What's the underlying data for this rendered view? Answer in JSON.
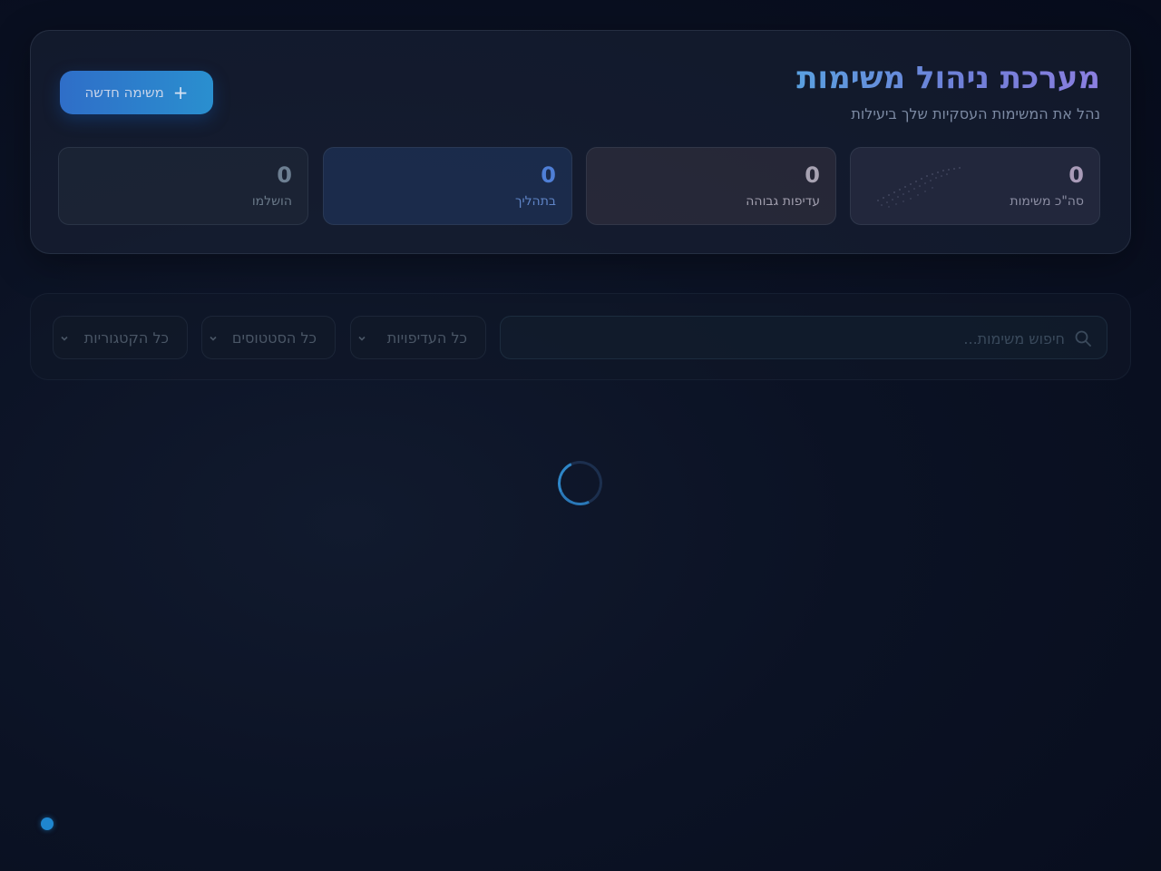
{
  "header": {
    "title": "מערכת ניהול משימות",
    "subtitle": "נהל את המשימות העסקיות שלך ביעילות",
    "new_task_button": {
      "icon": "plus-icon",
      "label": "משימה חדשה"
    }
  },
  "stats": [
    {
      "key": "total",
      "value": "0",
      "label": "סה\"כ משימות"
    },
    {
      "key": "high_priority",
      "value": "0",
      "label": "עדיפות גבוהה"
    },
    {
      "key": "in_progress",
      "value": "0",
      "label": "בתהליך"
    },
    {
      "key": "completed",
      "value": "0",
      "label": "הושלמו"
    }
  ],
  "filters": {
    "search": {
      "placeholder": "חיפוש משימות...",
      "icon": "search-icon"
    },
    "priority_select": {
      "selected": "כל העדיפויות"
    },
    "status_select": {
      "selected": "כל הסטטוסים"
    },
    "category_select": {
      "selected": "כל הקטגוריות"
    }
  },
  "loading": {
    "icon": "loading-spinner"
  },
  "colors": {
    "background": "#0b1224",
    "accent": "#2a8fcf",
    "title_gradient_start": "#5aa0e0",
    "title_gradient_end": "#8b7fe0",
    "in_progress": "#4f7fd6",
    "status_dot": "#1f86cf"
  }
}
